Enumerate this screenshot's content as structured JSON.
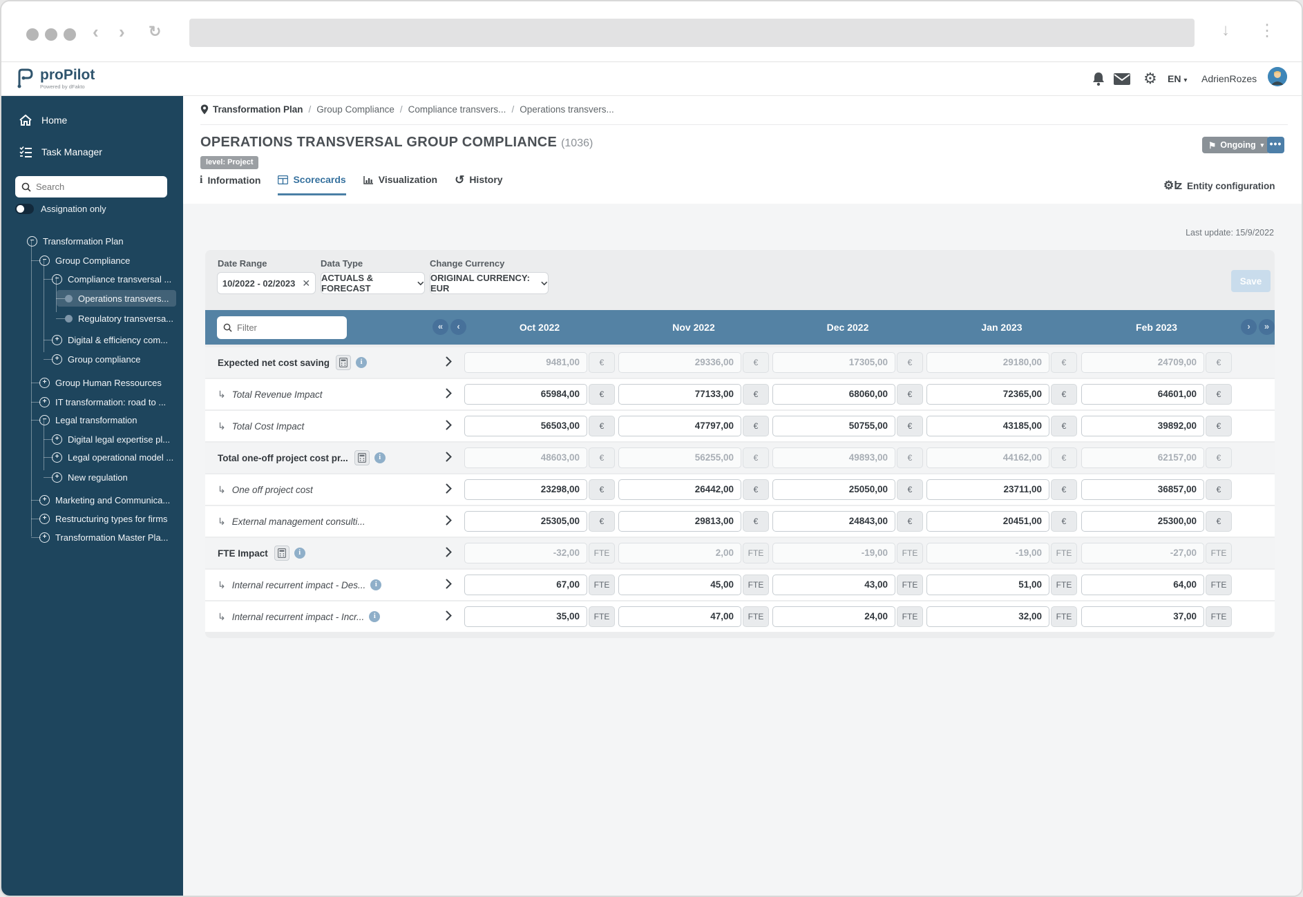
{
  "header": {
    "logo_title": "proPilot",
    "logo_sub": "Powered by dFakto",
    "lang": "EN",
    "user": "AdrienRozes"
  },
  "sidebar": {
    "home_label": "Home",
    "tasks_label": "Task Manager",
    "search_placeholder": "Search",
    "toggle_label": "Assignation only",
    "tree": [
      {
        "label": "Transformation Plan",
        "level": 0,
        "icon": "minus",
        "selected": false
      },
      {
        "label": "Group Compliance",
        "level": 1,
        "icon": "minus",
        "selected": false
      },
      {
        "label": "Compliance transversal ...",
        "level": 2,
        "icon": "minus",
        "selected": false
      },
      {
        "label": "Operations transvers...",
        "level": 3,
        "icon": "bullet",
        "selected": true
      },
      {
        "label": "Regulatory transversa...",
        "level": 3,
        "icon": "bullet",
        "selected": false
      },
      {
        "label": "Digital & efficiency com...",
        "level": 2,
        "icon": "plus",
        "selected": false
      },
      {
        "label": "Group compliance",
        "level": 2,
        "icon": "plus",
        "selected": false
      },
      {
        "label": "Group Human Ressources",
        "level": 1,
        "icon": "plus",
        "selected": false
      },
      {
        "label": "IT transformation: road to ...",
        "level": 1,
        "icon": "plus",
        "selected": false
      },
      {
        "label": "Legal transformation",
        "level": 1,
        "icon": "minus",
        "selected": false
      },
      {
        "label": "Digital legal expertise pl...",
        "level": 2,
        "icon": "plus",
        "selected": false
      },
      {
        "label": "Legal operational model ...",
        "level": 2,
        "icon": "plus",
        "selected": false
      },
      {
        "label": "New regulation",
        "level": 2,
        "icon": "plus",
        "selected": false
      },
      {
        "label": "Marketing and Communica...",
        "level": 1,
        "icon": "plus",
        "selected": false
      },
      {
        "label": "Restructuring types for firms",
        "level": 1,
        "icon": "plus",
        "selected": false
      },
      {
        "label": "Transformation Master Pla...",
        "level": 1,
        "icon": "plus",
        "selected": false
      }
    ]
  },
  "page": {
    "breadcrumb": [
      "Transformation Plan",
      "Group Compliance",
      "Compliance transvers...",
      "Operations transvers..."
    ],
    "title": "OPERATIONS TRANSVERSAL GROUP COMPLIANCE",
    "title_id": "(1036)",
    "level_badge": "level: Project",
    "status_button": "Ongoing",
    "more_button": "...",
    "tabs": [
      {
        "label": "Information",
        "active": false
      },
      {
        "label": "Scorecards",
        "active": true
      },
      {
        "label": "Visualization",
        "active": false
      },
      {
        "label": "History",
        "active": false
      }
    ],
    "entity_config_label": "Entity configuration",
    "last_update": "Last update: 15/9/2022"
  },
  "filters": {
    "date_range": {
      "label": "Date Range",
      "value": "10/2022 - 02/2023"
    },
    "data_type": {
      "label": "Data Type",
      "value": "ACTUALS & FORECAST"
    },
    "currency": {
      "label": "Change Currency",
      "value": "ORIGINAL CURRENCY: EUR"
    },
    "save_label": "Save"
  },
  "table": {
    "filter_placeholder": "Filter",
    "columns": [
      "Oct 2022",
      "Nov 2022",
      "Dec 2022",
      "Jan 2023",
      "Feb 2023"
    ],
    "rows": [
      {
        "label": "Expected net cost saving",
        "type": "aggregate",
        "unit": "€",
        "has_calc": true,
        "has_info": true,
        "values": [
          "9481,00",
          "29336,00",
          "17305,00",
          "29180,00",
          "24709,00"
        ]
      },
      {
        "label": "Total Revenue Impact",
        "type": "child",
        "unit": "€",
        "has_calc": false,
        "has_info": false,
        "values": [
          "65984,00",
          "77133,00",
          "68060,00",
          "72365,00",
          "64601,00"
        ]
      },
      {
        "label": "Total Cost Impact",
        "type": "child",
        "unit": "€",
        "has_calc": false,
        "has_info": false,
        "values": [
          "56503,00",
          "47797,00",
          "50755,00",
          "43185,00",
          "39892,00"
        ]
      },
      {
        "label": "Total one-off project cost pr...",
        "type": "aggregate",
        "unit": "€",
        "has_calc": true,
        "has_info": true,
        "values": [
          "48603,00",
          "56255,00",
          "49893,00",
          "44162,00",
          "62157,00"
        ]
      },
      {
        "label": "One off project cost",
        "type": "child",
        "unit": "€",
        "has_calc": false,
        "has_info": false,
        "values": [
          "23298,00",
          "26442,00",
          "25050,00",
          "23711,00",
          "36857,00"
        ]
      },
      {
        "label": "External management consulti...",
        "type": "child",
        "unit": "€",
        "has_calc": false,
        "has_info": false,
        "values": [
          "25305,00",
          "29813,00",
          "24843,00",
          "20451,00",
          "25300,00"
        ]
      },
      {
        "label": "FTE Impact",
        "type": "aggregate",
        "unit": "FTE",
        "has_calc": true,
        "has_info": true,
        "values": [
          "-32,00",
          "2,00",
          "-19,00",
          "-19,00",
          "-27,00"
        ]
      },
      {
        "label": "Internal recurrent impact - Des...",
        "type": "child",
        "unit": "FTE",
        "has_calc": false,
        "has_info": true,
        "values": [
          "67,00",
          "45,00",
          "43,00",
          "51,00",
          "64,00"
        ]
      },
      {
        "label": "Internal recurrent impact - Incr...",
        "type": "child",
        "unit": "FTE",
        "has_calc": false,
        "has_info": true,
        "values": [
          "35,00",
          "47,00",
          "24,00",
          "32,00",
          "37,00"
        ]
      }
    ]
  },
  "colors": {
    "sidebar_bg": "#1e455d",
    "table_header_bg": "#5482a4",
    "accent_blue": "#36719e",
    "status_button_bg": "#8a9197",
    "more_button_bg": "#4d7fa8",
    "badge_bg": "#9b9fa3",
    "card_bg": "#ecedee"
  }
}
